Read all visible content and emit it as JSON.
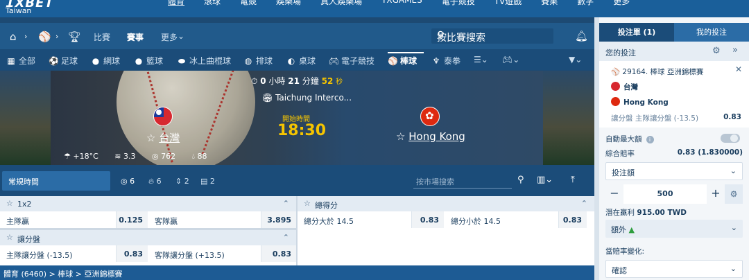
{
  "brand": {
    "logo": "1XBET",
    "region": "Taiwan"
  },
  "topnav": [
    "體育",
    "滾球",
    "電競",
    "娛樂場",
    "真人娛樂場",
    "TXGAMES",
    "電子競技",
    "TV遊戲",
    "賽果",
    "數字",
    "更多"
  ],
  "subnav": {
    "tabs": [
      "比賽",
      "賽事",
      "更多"
    ],
    "search_placeholder": "按比賽搜索"
  },
  "sports": [
    {
      "icon": "grid-icon",
      "label": "全部"
    },
    {
      "icon": "soccer-icon",
      "label": "足球"
    },
    {
      "icon": "tennis-icon",
      "label": "網球"
    },
    {
      "icon": "basketball-icon",
      "label": "籃球"
    },
    {
      "icon": "hockey-icon",
      "label": "冰上曲棍球"
    },
    {
      "icon": "volleyball-icon",
      "label": "排球"
    },
    {
      "icon": "table-tennis-icon",
      "label": "桌球"
    },
    {
      "icon": "gamepad-icon",
      "label": "電子競技"
    },
    {
      "icon": "baseball-icon",
      "label": "棒球"
    },
    {
      "icon": "boxing-icon",
      "label": "泰拳"
    }
  ],
  "match": {
    "countdown": {
      "hours": "0",
      "hours_unit": "小時",
      "minutes": "21",
      "minutes_unit": "分鐘",
      "seconds": "52",
      "seconds_unit": "秒"
    },
    "stadium": "Taichung Interco...",
    "start_label": "開始時間",
    "start_time": "18:30",
    "home": "台灣",
    "away": "Hong Kong",
    "weather": {
      "temp": "+18°C",
      "wind": "3.3",
      "pressure": "762",
      "humidity": "88"
    }
  },
  "market_bar": {
    "period": "常規時間",
    "counts": [
      "6",
      "6",
      "2",
      "2"
    ],
    "search_placeholder": "按市場搜索"
  },
  "markets": {
    "m1x2": {
      "title": "1x2",
      "home_label": "主隊贏",
      "home_odd": "0.125",
      "away_label": "客隊贏",
      "away_odd": "3.895"
    },
    "handicap": {
      "title": "讓分盤",
      "home_label": "主隊讓分盤 (-13.5)",
      "home_odd": "0.83",
      "away_label": "客隊讓分盤 (+13.5)",
      "away_odd": "0.83"
    },
    "total": {
      "title": "總得分",
      "over_label": "總分大於 14.5",
      "over_odd": "0.83",
      "under_label": "總分小於 14.5",
      "under_odd": "0.83"
    }
  },
  "breadcrumb": "體育 (6460) > 棒球 > 亞洲錦標賽",
  "slip": {
    "tab_active": "投注單 (1)",
    "tab_other": "我的投注",
    "header": "您的投注",
    "event": "29164. 棒球 亞洲錦標賽",
    "team1": "台灣",
    "team2": "Hong Kong",
    "market": "讓分盤 主隊讓分盤 (-13.5)",
    "odd": "0.83",
    "auto_max": "自動最大額",
    "combined_label": "綜合賠率",
    "combined_value": "0.83 (1.830000)",
    "stake_label": "投注額",
    "stake_value": "500",
    "profit_label": "潛在贏利",
    "profit_value": "915.00 TWD",
    "extra": "額外",
    "odds_change_label": "當賠率變化:",
    "odds_change_value": "確認"
  },
  "colors": {
    "nav_blue": "#1a5f9a",
    "panel_blue": "#1b4c79",
    "accent_yellow": "#f5c400"
  }
}
